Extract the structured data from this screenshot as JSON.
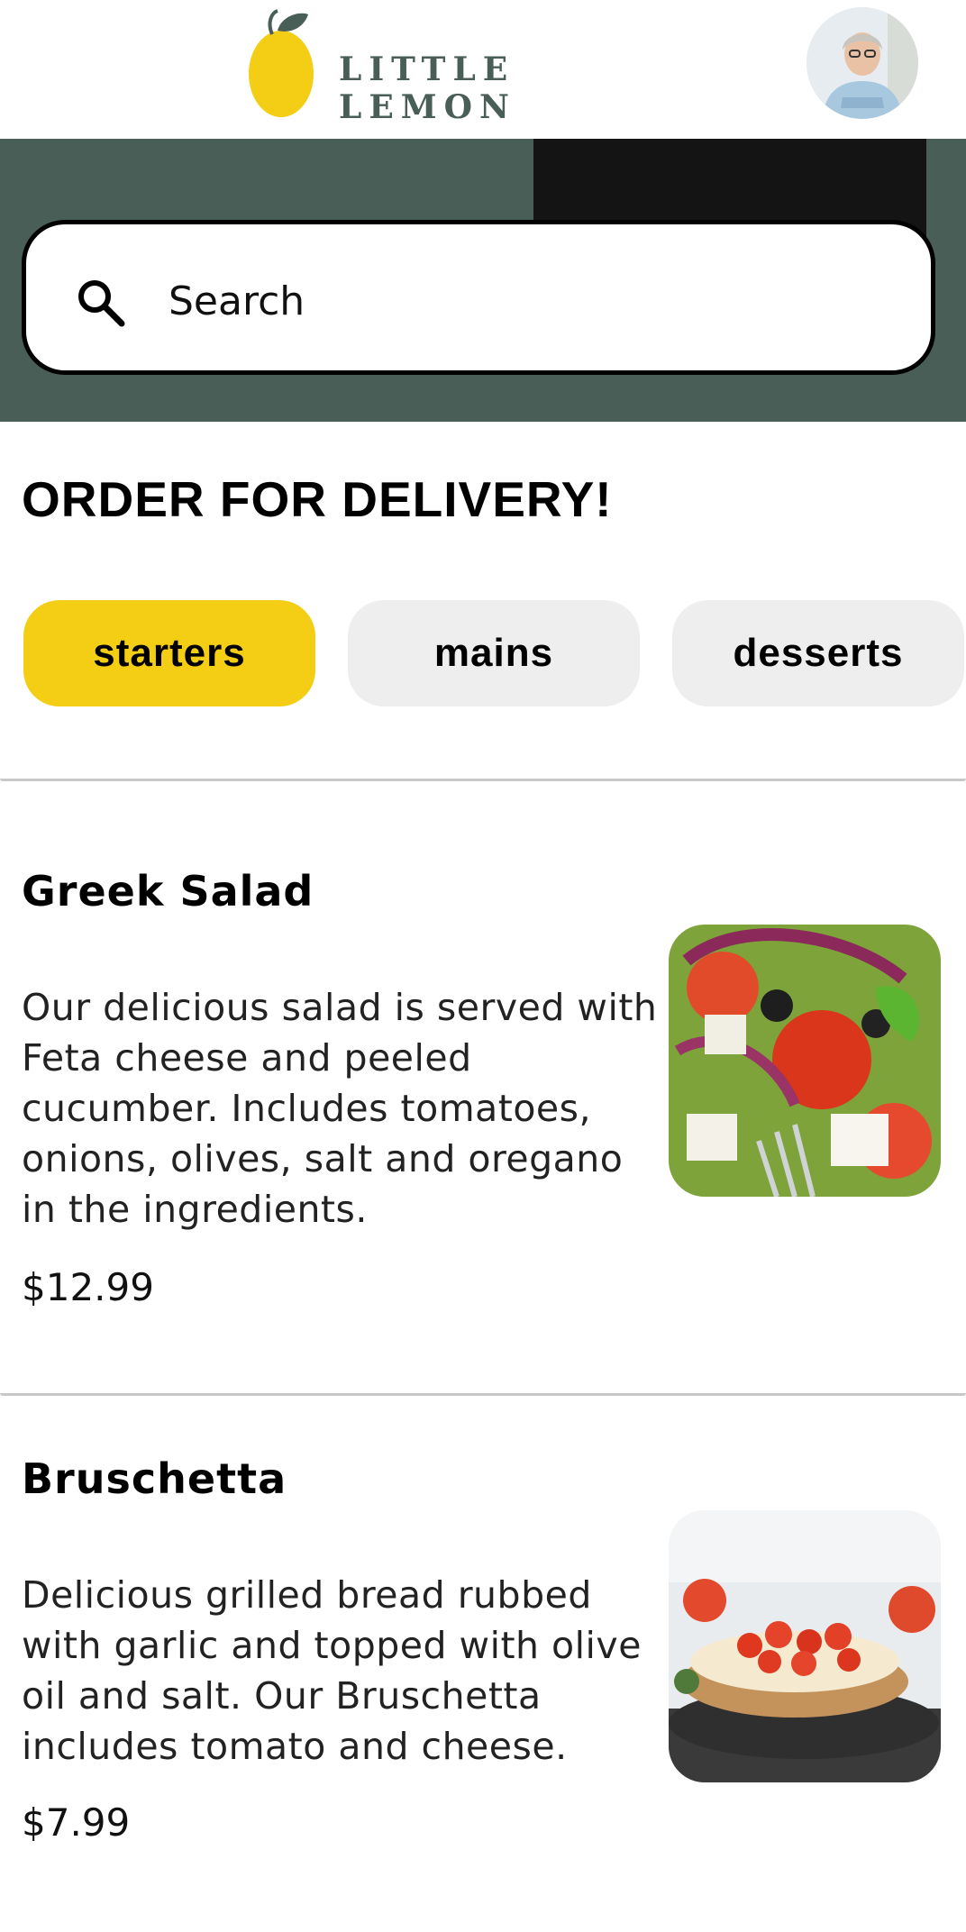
{
  "header": {
    "brand": "LITTLE LEMON",
    "logo_icon": "lemon-icon",
    "avatar_icon": "profile-photo"
  },
  "search": {
    "placeholder": "Search",
    "icon": "search-icon"
  },
  "delivery": {
    "title": "ORDER FOR DELIVERY!",
    "categories": [
      {
        "label": "starters",
        "selected": true
      },
      {
        "label": "mains",
        "selected": false
      },
      {
        "label": "desserts",
        "selected": false
      }
    ]
  },
  "menu": {
    "items": [
      {
        "title": "Greek Salad",
        "description": "Our delicious salad is served with Feta cheese and peeled cucumber. Includes tomatoes, onions, olives, salt and oregano in the ingredients.",
        "price": "$12.99"
      },
      {
        "title": "Bruschetta",
        "description": "Delicious grilled bread rubbed with garlic and topped with olive oil and salt. Our Bruschetta includes tomato and cheese.",
        "price": "$7.99"
      }
    ]
  },
  "colors": {
    "brand_green": "#495e57",
    "brand_yellow": "#f4ce14",
    "chip_gray": "#eeeeee"
  }
}
